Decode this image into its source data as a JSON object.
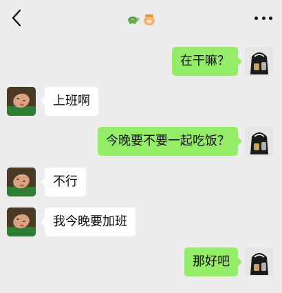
{
  "header": {
    "title_icons": [
      "turtle-emoji",
      "honey-pot-emoji"
    ],
    "back_icon": "chevron-left-icon",
    "more_icon": "more-dots-icon"
  },
  "colors": {
    "background": "#ededed",
    "outgoing_bubble": "#95ec69",
    "incoming_bubble": "#ffffff"
  },
  "messages": [
    {
      "side": "out",
      "text": "在干嘛？"
    },
    {
      "side": "in",
      "text": "上班啊"
    },
    {
      "side": "out",
      "text": "今晚要不要一起吃饭？"
    },
    {
      "side": "in",
      "text": "不行"
    },
    {
      "side": "in",
      "text": "我今晚要加班"
    },
    {
      "side": "out",
      "text": "那好吧"
    }
  ]
}
